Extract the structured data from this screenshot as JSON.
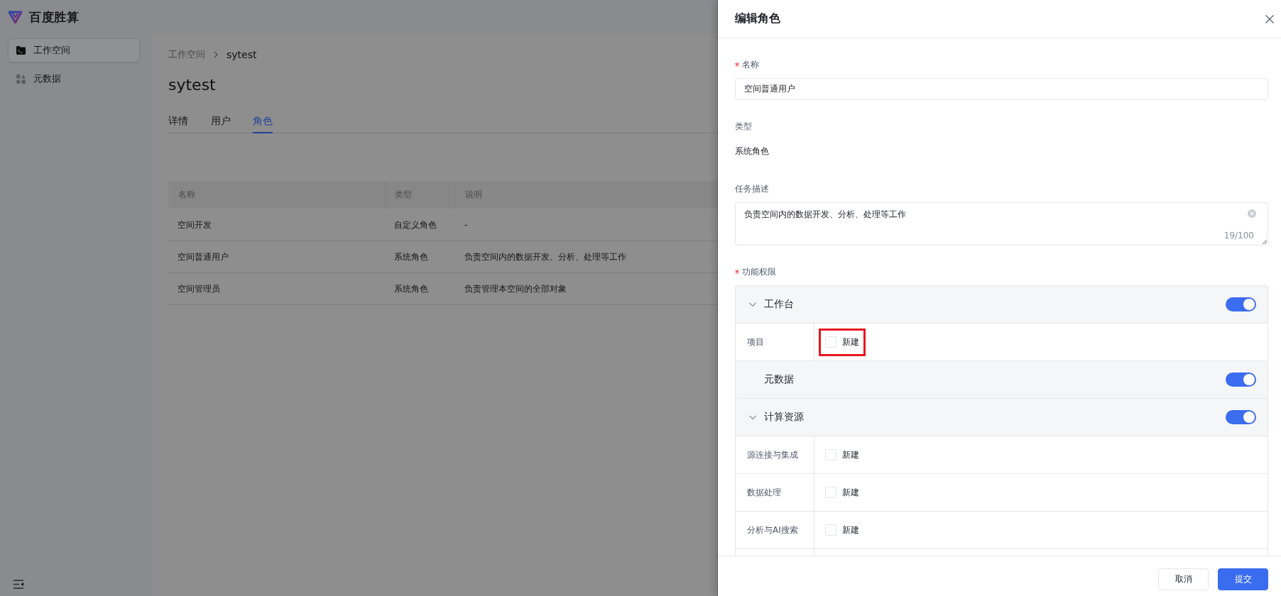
{
  "header": {
    "product_name": "百度胜算"
  },
  "sidebar": {
    "items": [
      {
        "label": "工作空间",
        "selected": true
      },
      {
        "label": "元数据",
        "selected": false
      }
    ]
  },
  "breadcrumb": [
    {
      "label": "工作空间"
    },
    {
      "label": "sytest"
    }
  ],
  "page": {
    "title": "sytest",
    "tabs": [
      {
        "label": "详情",
        "selected": false
      },
      {
        "label": "用户",
        "selected": false
      },
      {
        "label": "角色",
        "selected": true
      }
    ]
  },
  "table": {
    "columns": [
      "名称",
      "类型",
      "说明"
    ],
    "rows": [
      {
        "cells": [
          "空间开发",
          "自定义角色",
          "-"
        ]
      },
      {
        "cells": [
          "空间普通用户",
          "系统角色",
          "负责空间内的数据开发、分析、处理等工作"
        ]
      },
      {
        "cells": [
          "空间管理员",
          "系统角色",
          "负责管理本空间的全部对象"
        ]
      }
    ]
  },
  "drawer": {
    "title": "编辑角色",
    "form": {
      "name": {
        "label": "名称",
        "required": true,
        "value": "空间普通用户"
      },
      "type": {
        "label": "类型",
        "required": false,
        "value": "系统角色"
      },
      "description": {
        "label": "任务描述",
        "required": false,
        "value": "负责空间内的数据开发、分析、处理等工作",
        "counter": "19/100"
      },
      "permissions": {
        "label": "功能权限",
        "required": true,
        "groups": [
          {
            "name": "工作台",
            "on": true,
            "children": [
              {
                "name": "项目",
                "options": [
                  {
                    "label": "新建",
                    "checked": false,
                    "highlighted": true
                  }
                ]
              }
            ]
          },
          {
            "name": "元数据",
            "on": true
          },
          {
            "name": "计算资源",
            "on": true,
            "children": [
              {
                "name": "源连接与集成",
                "options": [
                  {
                    "label": "新建",
                    "checked": false,
                    "highlighted": false
                  }
                ]
              },
              {
                "name": "数据处理",
                "options": [
                  {
                    "label": "新建",
                    "checked": false,
                    "highlighted": false
                  }
                ]
              },
              {
                "name": "分析与AI搜索",
                "options": [
                  {
                    "label": "新建",
                    "checked": false,
                    "highlighted": false
                  }
                ]
              }
            ]
          }
        ]
      }
    },
    "buttons": [
      {
        "label": "取消",
        "kind": "secondary"
      },
      {
        "label": "提交",
        "kind": "primary"
      }
    ]
  }
}
